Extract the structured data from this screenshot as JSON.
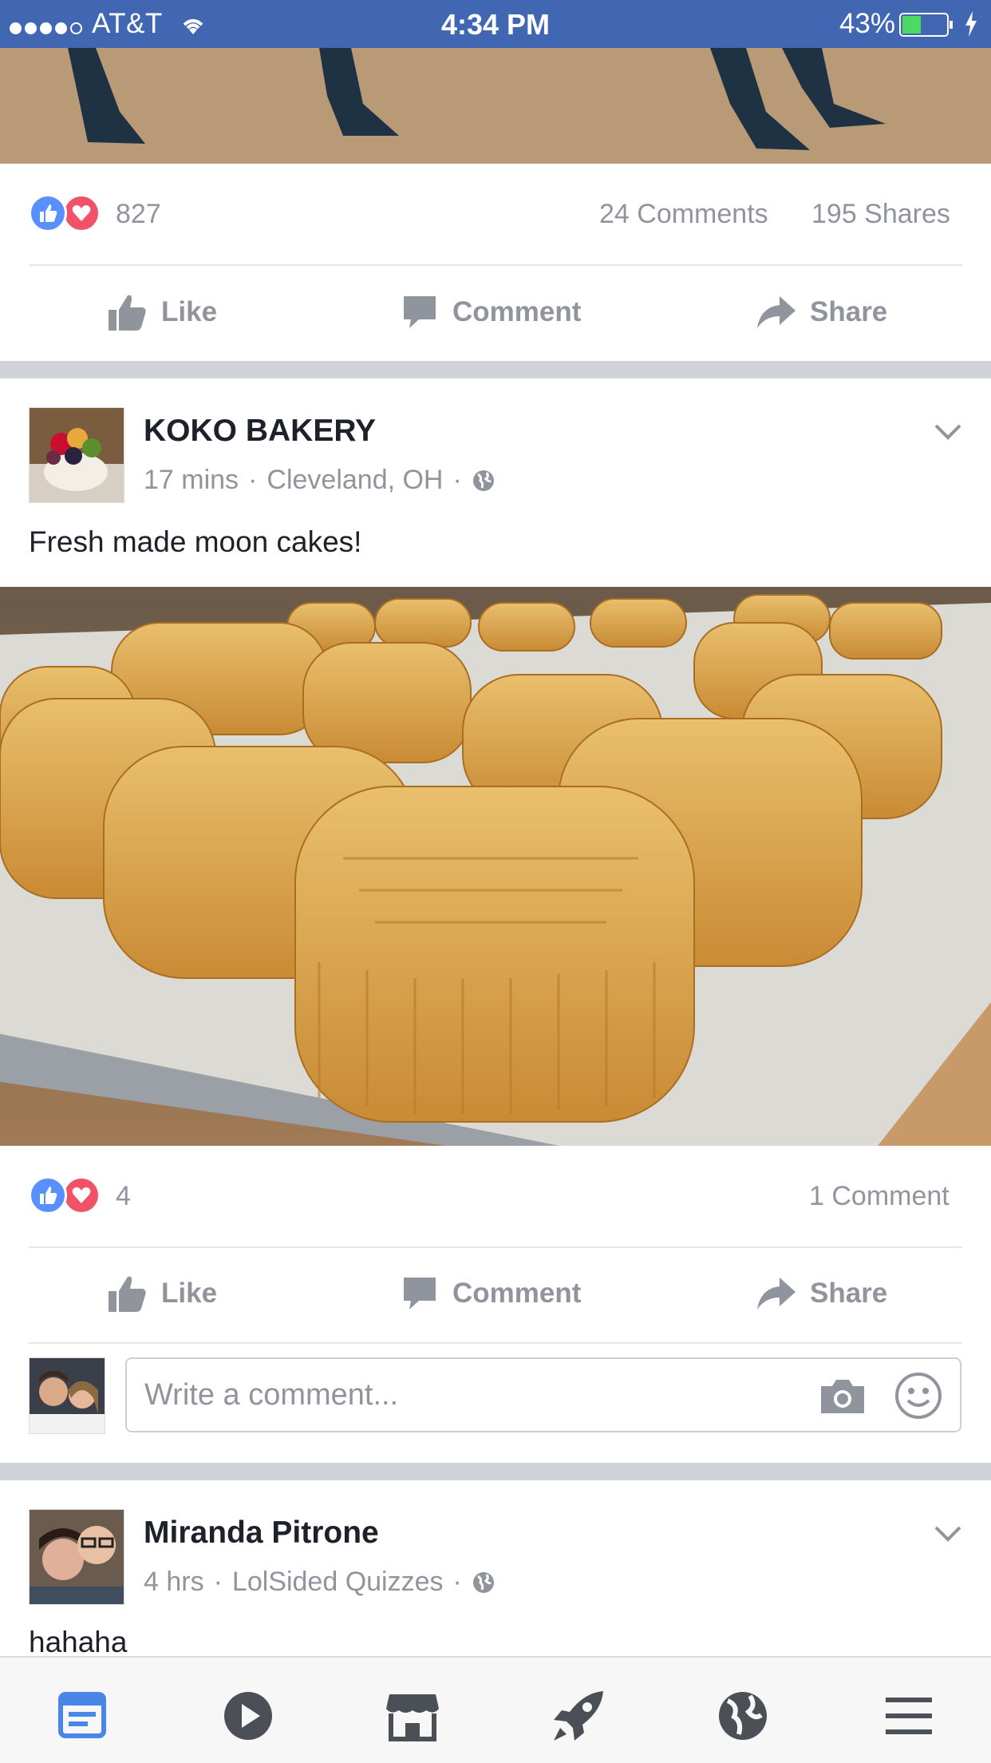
{
  "status_bar": {
    "carrier": "AT&T",
    "time": "4:34 PM",
    "battery_percent": "43%",
    "battery_level": 0.43,
    "signal_bars": 4
  },
  "previous_post": {
    "reaction_count": "827",
    "comments": "24 Comments",
    "shares": "195 Shares",
    "actions": {
      "like": "Like",
      "comment": "Comment",
      "share": "Share"
    }
  },
  "post": {
    "author": "KOKO BAKERY",
    "time": "17 mins",
    "location": "Cleveland, OH",
    "separator": "·",
    "text": "Fresh made moon cakes!",
    "reaction_count": "4",
    "comments": "1 Comment",
    "actions": {
      "like": "Like",
      "comment": "Comment",
      "share": "Share"
    },
    "comment_placeholder": "Write a comment..."
  },
  "next_post": {
    "author": "Miranda Pitrone",
    "time": "4 hrs",
    "source": "LolSided Quizzes",
    "separator": "·",
    "text": "hahaha"
  },
  "tab_bar": {
    "items": [
      "news-feed-icon",
      "video-icon",
      "marketplace-icon",
      "explore-icon",
      "notifications-globe-icon",
      "menu-icon"
    ],
    "active_index": 0
  },
  "colors": {
    "brand": "#4267b2",
    "like_blue": "#5890ff",
    "love_red": "#f25268",
    "muted": "#90949c",
    "active_tab": "#4a86e8"
  }
}
